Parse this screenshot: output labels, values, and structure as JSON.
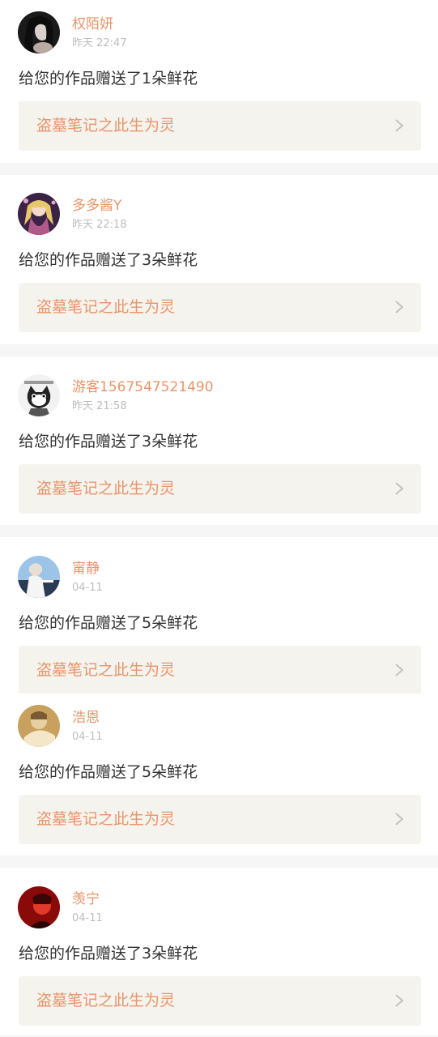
{
  "notifications": [
    {
      "username": "权陌妍",
      "time": "昨天 22:47",
      "message": "给您的作品赠送了1朵鲜花",
      "work_title": "盗墓笔记之此生为灵",
      "avatar_icon": "avatar-dark-hair-girl-icon"
    },
    {
      "username": "多多酱Y",
      "time": "昨天 22:18",
      "message": "给您的作品赠送了3朵鲜花",
      "work_title": "盗墓笔记之此生为灵",
      "avatar_icon": "avatar-anime-girl-icon"
    },
    {
      "username": "游客1567547521490",
      "time": "昨天 21:58",
      "message": "给您的作品赠送了3朵鲜花",
      "work_title": "盗墓笔记之此生为灵",
      "avatar_icon": "avatar-cartoon-cat-icon"
    },
    {
      "username": "甯静",
      "time": "04-11",
      "message": "给您的作品赠送了5朵鲜花",
      "work_title": "盗墓笔记之此生为灵",
      "avatar_icon": "avatar-sky-girl-icon"
    },
    {
      "username": "浩恩",
      "time": "04-11",
      "message": "给您的作品赠送了5朵鲜花",
      "work_title": "盗墓笔记之此生为灵",
      "avatar_icon": "avatar-warm-photo-icon"
    },
    {
      "username": "羡宁",
      "time": "04-11",
      "message": "给您的作品赠送了3朵鲜花",
      "work_title": "盗墓笔记之此生为灵",
      "avatar_icon": "avatar-red-portrait-icon"
    }
  ],
  "colors": {
    "accent": "#e8956a",
    "message_text": "#333333",
    "time_text": "#bdbdbd",
    "link_background": "#f4f3ed",
    "separator": "#f6f6f6"
  }
}
